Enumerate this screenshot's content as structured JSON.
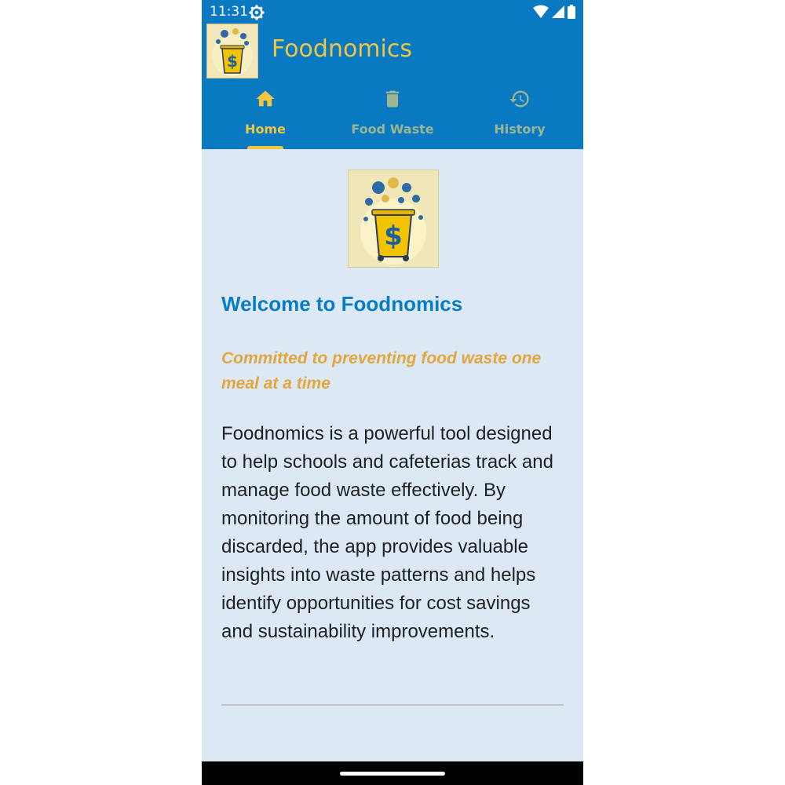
{
  "status_bar": {
    "time": "11:31",
    "icons": [
      "settings-gear-icon",
      "wifi-icon",
      "signal-icon",
      "battery-icon"
    ]
  },
  "app_bar": {
    "title": "Foodnomics",
    "logo_icon": "trash-bin-dollar-logo"
  },
  "tabs": [
    {
      "label": "Home",
      "icon": "home-icon",
      "active": true
    },
    {
      "label": "Food Waste",
      "icon": "trash-icon",
      "active": false
    },
    {
      "label": "History",
      "icon": "history-icon",
      "active": false
    }
  ],
  "main": {
    "welcome_title": "Welcome to Foodnomics",
    "tagline": "Committed to preventing food waste one meal at a time",
    "description": "Foodnomics is a powerful tool designed to help schools and cafeterias track and manage food waste effectively. By monitoring the amount of food being discarded, the app provides valuable insights into waste patterns and helps identify opportunities for cost savings and sustainability improvements."
  },
  "colors": {
    "app_bar": "#0979c2",
    "accent_yellow": "#f2c542",
    "background": "#dce8f4",
    "title_blue": "#0a7cc2",
    "tagline_orange": "#e2a73c",
    "inactive_tab": "#9eb591"
  }
}
